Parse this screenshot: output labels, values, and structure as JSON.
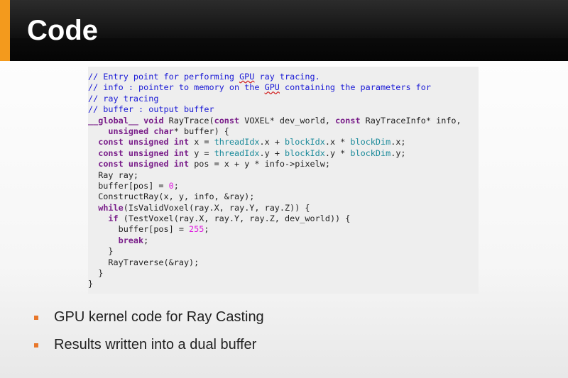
{
  "slide": {
    "title": "Code",
    "accent_color": "#f39a1d",
    "bullet_color": "#e8772a"
  },
  "code": {
    "lines": [
      "// Entry point for performing GPU ray tracing.",
      "// info : pointer to memory on the GPU containing the parameters for",
      "// ray tracing",
      "// buffer : output buffer",
      "__global__ void RayTrace(const VOXEL* dev_world, const RayTraceInfo* info,",
      "    unsigned char* buffer) {",
      "  const unsigned int x = threadIdx.x + blockIdx.x * blockDim.x;",
      "  const unsigned int y = threadIdx.y + blockIdx.y * blockDim.y;",
      "  const unsigned int pos = x + y * info->pixelw;",
      "  Ray ray;",
      "  buffer[pos] = 0;",
      "  ConstructRay(x, y, info, &ray);",
      "  while(IsValidVoxel(ray.X, ray.Y, ray.Z)) {",
      "    if (TestVoxel(ray.X, ray.Y, ray.Z, dev_world)) {",
      "      buffer[pos] = 255;",
      "      break;",
      "    }",
      "    RayTraverse(&ray);",
      "  }",
      "}"
    ]
  },
  "bullets": [
    {
      "text": "GPU kernel code for Ray Casting"
    },
    {
      "text": "Results written into a dual buffer"
    }
  ]
}
